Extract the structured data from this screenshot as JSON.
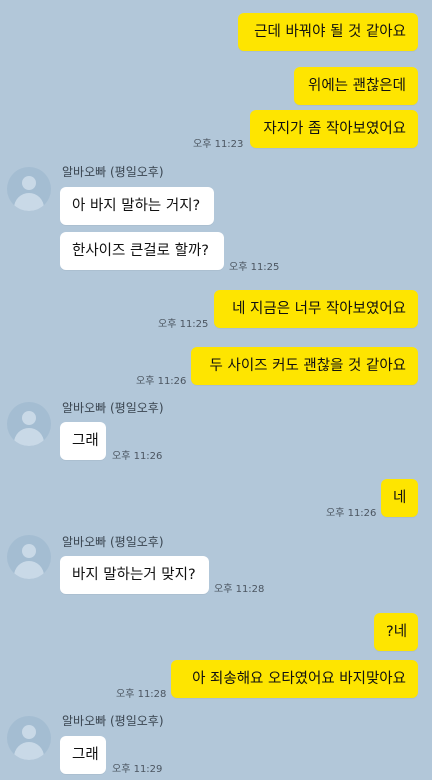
{
  "chat": {
    "sender_name": "알바오빠 (평일오후)",
    "messages": [
      {
        "from": "me",
        "text": "근데 바꿔야 될 것 같아요"
      },
      {
        "from": "me",
        "text": "위에는 괜찮은데"
      },
      {
        "from": "me",
        "text": "자지가 좀 작아보였어요",
        "time": "오후 11:23"
      },
      {
        "from": "other",
        "text": "아 바지 말하는 거지?"
      },
      {
        "from": "other",
        "text": "한사이즈 큰걸로 할까?",
        "time": "오후 11:25"
      },
      {
        "from": "me",
        "text": "네 지금은 너무 작아보였어요",
        "time": "오후 11:25"
      },
      {
        "from": "me",
        "text": "두 사이즈 커도 괜찮을 것 같아요",
        "time": "오후 11:26"
      },
      {
        "from": "other",
        "text": "그래",
        "time": "오후 11:26"
      },
      {
        "from": "me",
        "text": "네",
        "time": "오후 11:26"
      },
      {
        "from": "other",
        "text": "바지 말하는거 맞지?",
        "time": "오후 11:28"
      },
      {
        "from": "me",
        "text": "?네"
      },
      {
        "from": "me",
        "text": "아 죄송해요 오타였어요 바지맞아요",
        "time": "오후 11:28"
      },
      {
        "from": "other",
        "text": "그래",
        "time": "오후 11:29"
      }
    ]
  },
  "colors": {
    "background": "#b2c7d9",
    "my_bubble": "#fee500",
    "other_bubble": "#ffffff"
  },
  "icons": {
    "avatar": "default-profile-icon"
  }
}
